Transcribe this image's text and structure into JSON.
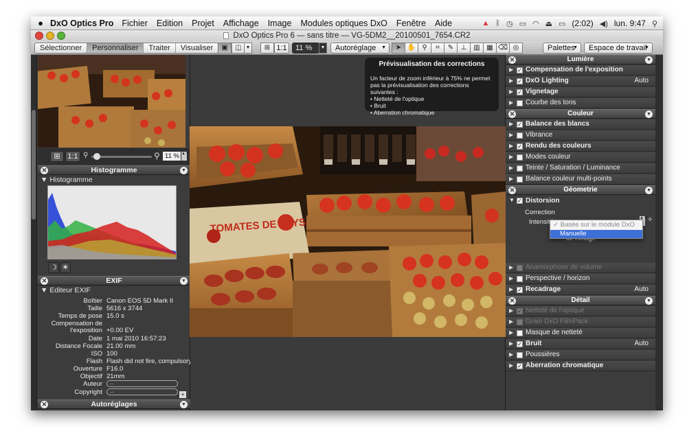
{
  "menubar": {
    "app_name": "DxO Optics Pro",
    "items": [
      "Fichier",
      "Edition",
      "Projet",
      "Affichage",
      "Image",
      "Modules optiques DxO",
      "Fenêtre",
      "Aide"
    ],
    "battery": "(2:02)",
    "clock": "lun. 9:47"
  },
  "window": {
    "title": "DxO Optics Pro 6 — sans titre — VG-5DM2__20100501_7654.CR2"
  },
  "toolbar": {
    "tabs": [
      "Sélectionner",
      "Personnaliser",
      "Traiter",
      "Visualiser"
    ],
    "selected_tab": "Personnaliser",
    "ratio": "1:1",
    "zoom": "11 %",
    "preset": "Autoréglage",
    "palettes": "Palettes",
    "workspace": "Espace de travail"
  },
  "navigator": {
    "ratio": "1:1",
    "zoom": "11 %"
  },
  "histogram": {
    "panel_title": "Histogramme",
    "sub_title": "Histogramme"
  },
  "exif": {
    "panel_title": "EXIF",
    "sub_title": "Editeur EXIF",
    "rows": [
      {
        "k": "Boîtier",
        "v": "Canon EOS 5D Mark II"
      },
      {
        "k": "Taille",
        "v": "5616 x 3744"
      },
      {
        "k": "Temps de pose",
        "v": "15.0 s"
      },
      {
        "k": "Compensation de",
        "v": ""
      },
      {
        "k": "l'exposition",
        "v": "+0.00 EV"
      },
      {
        "k": "Date",
        "v": "1 mai 2010 16:57:23"
      },
      {
        "k": "Distance Focale",
        "v": "21.00 mm"
      },
      {
        "k": "ISO",
        "v": "100"
      },
      {
        "k": "Flash",
        "v": "Flash did not fire, compulsory fl..."
      },
      {
        "k": "Ouverture",
        "v": "F16.0"
      },
      {
        "k": "Objectif",
        "v": "21mm"
      },
      {
        "k": "Auteur",
        "v": "..."
      },
      {
        "k": "Copyright",
        "v": "..."
      }
    ]
  },
  "autoreglages": {
    "panel_title": "Autoréglages"
  },
  "preview": {
    "title": "Prévisualisation des corrections",
    "text": "Un facteur de zoom inférieur à 75% ne permet pas la prévisualisation des corrections suivantes :",
    "items": [
      "Netteté de l'optique",
      "Bruit",
      "Aberration chromatique"
    ]
  },
  "photo": {
    "sign_text": "TOMATES DE PAYS"
  },
  "right_panel": {
    "sections": [
      {
        "title": "Lumière",
        "rows": [
          {
            "label": "Compensation de l'exposition",
            "checked": true,
            "bold": true,
            "auto": ""
          },
          {
            "label": "DxO Lighting",
            "checked": true,
            "bold": true,
            "auto": "Auto"
          },
          {
            "label": "Vignetage",
            "checked": true,
            "bold": true,
            "auto": ""
          },
          {
            "label": "Courbe des tons",
            "checked": false,
            "bold": false,
            "auto": ""
          }
        ]
      },
      {
        "title": "Couleur",
        "rows": [
          {
            "label": "Balance des blancs",
            "checked": true,
            "bold": true,
            "auto": ""
          },
          {
            "label": "Vibrance",
            "checked": false,
            "bold": false,
            "auto": ""
          },
          {
            "label": "Rendu des couleurs",
            "checked": true,
            "bold": true,
            "auto": ""
          },
          {
            "label": "Modes couleur",
            "checked": false,
            "bold": false,
            "auto": ""
          },
          {
            "label": "Teinte / Saturation / Luminance",
            "checked": false,
            "bold": false,
            "auto": ""
          },
          {
            "label": "Balance couleur multi-points",
            "checked": false,
            "bold": false,
            "auto": ""
          }
        ]
      },
      {
        "title": "Géometrie",
        "rows": []
      },
      {
        "title": "Détail",
        "rows": []
      }
    ],
    "distorsion": {
      "label": "Distorsion",
      "correction_label": "Correction",
      "intensity_label": "Intensité",
      "options": [
        "Basée sur le module DxO",
        "Manuelle"
      ],
      "selected": "Manuelle",
      "keep_proportions": "Conserver les proportions de l'image"
    },
    "geometry_rows": [
      {
        "label": "Anamorphose de volume",
        "checked": false,
        "bold": false,
        "dim": true,
        "auto": ""
      },
      {
        "label": "Perspective / horizon",
        "checked": false,
        "bold": false,
        "dim": false,
        "auto": ""
      },
      {
        "label": "Recadrage",
        "checked": true,
        "bold": true,
        "dim": false,
        "auto": "Auto"
      }
    ],
    "detail_rows": [
      {
        "label": "Netteté de l'optique",
        "checked": true,
        "bold": false,
        "dim": true,
        "auto": ""
      },
      {
        "label": "Grain DxO FilmPack",
        "checked": false,
        "bold": false,
        "dim": true,
        "auto": ""
      },
      {
        "label": "Masque de netteté",
        "checked": false,
        "bold": false,
        "dim": false,
        "auto": ""
      },
      {
        "label": "Bruit",
        "checked": true,
        "bold": true,
        "dim": false,
        "auto": "Auto"
      },
      {
        "label": "Poussières",
        "checked": false,
        "bold": false,
        "dim": false,
        "auto": ""
      },
      {
        "label": "Aberration chromatique",
        "checked": true,
        "bold": true,
        "dim": false,
        "auto": ""
      }
    ]
  },
  "colors": {
    "accent_selection": "#3d6fd6",
    "panel_bg": "#3c3c3c",
    "tomato": "#c8261a",
    "crate": "#a0692f"
  }
}
